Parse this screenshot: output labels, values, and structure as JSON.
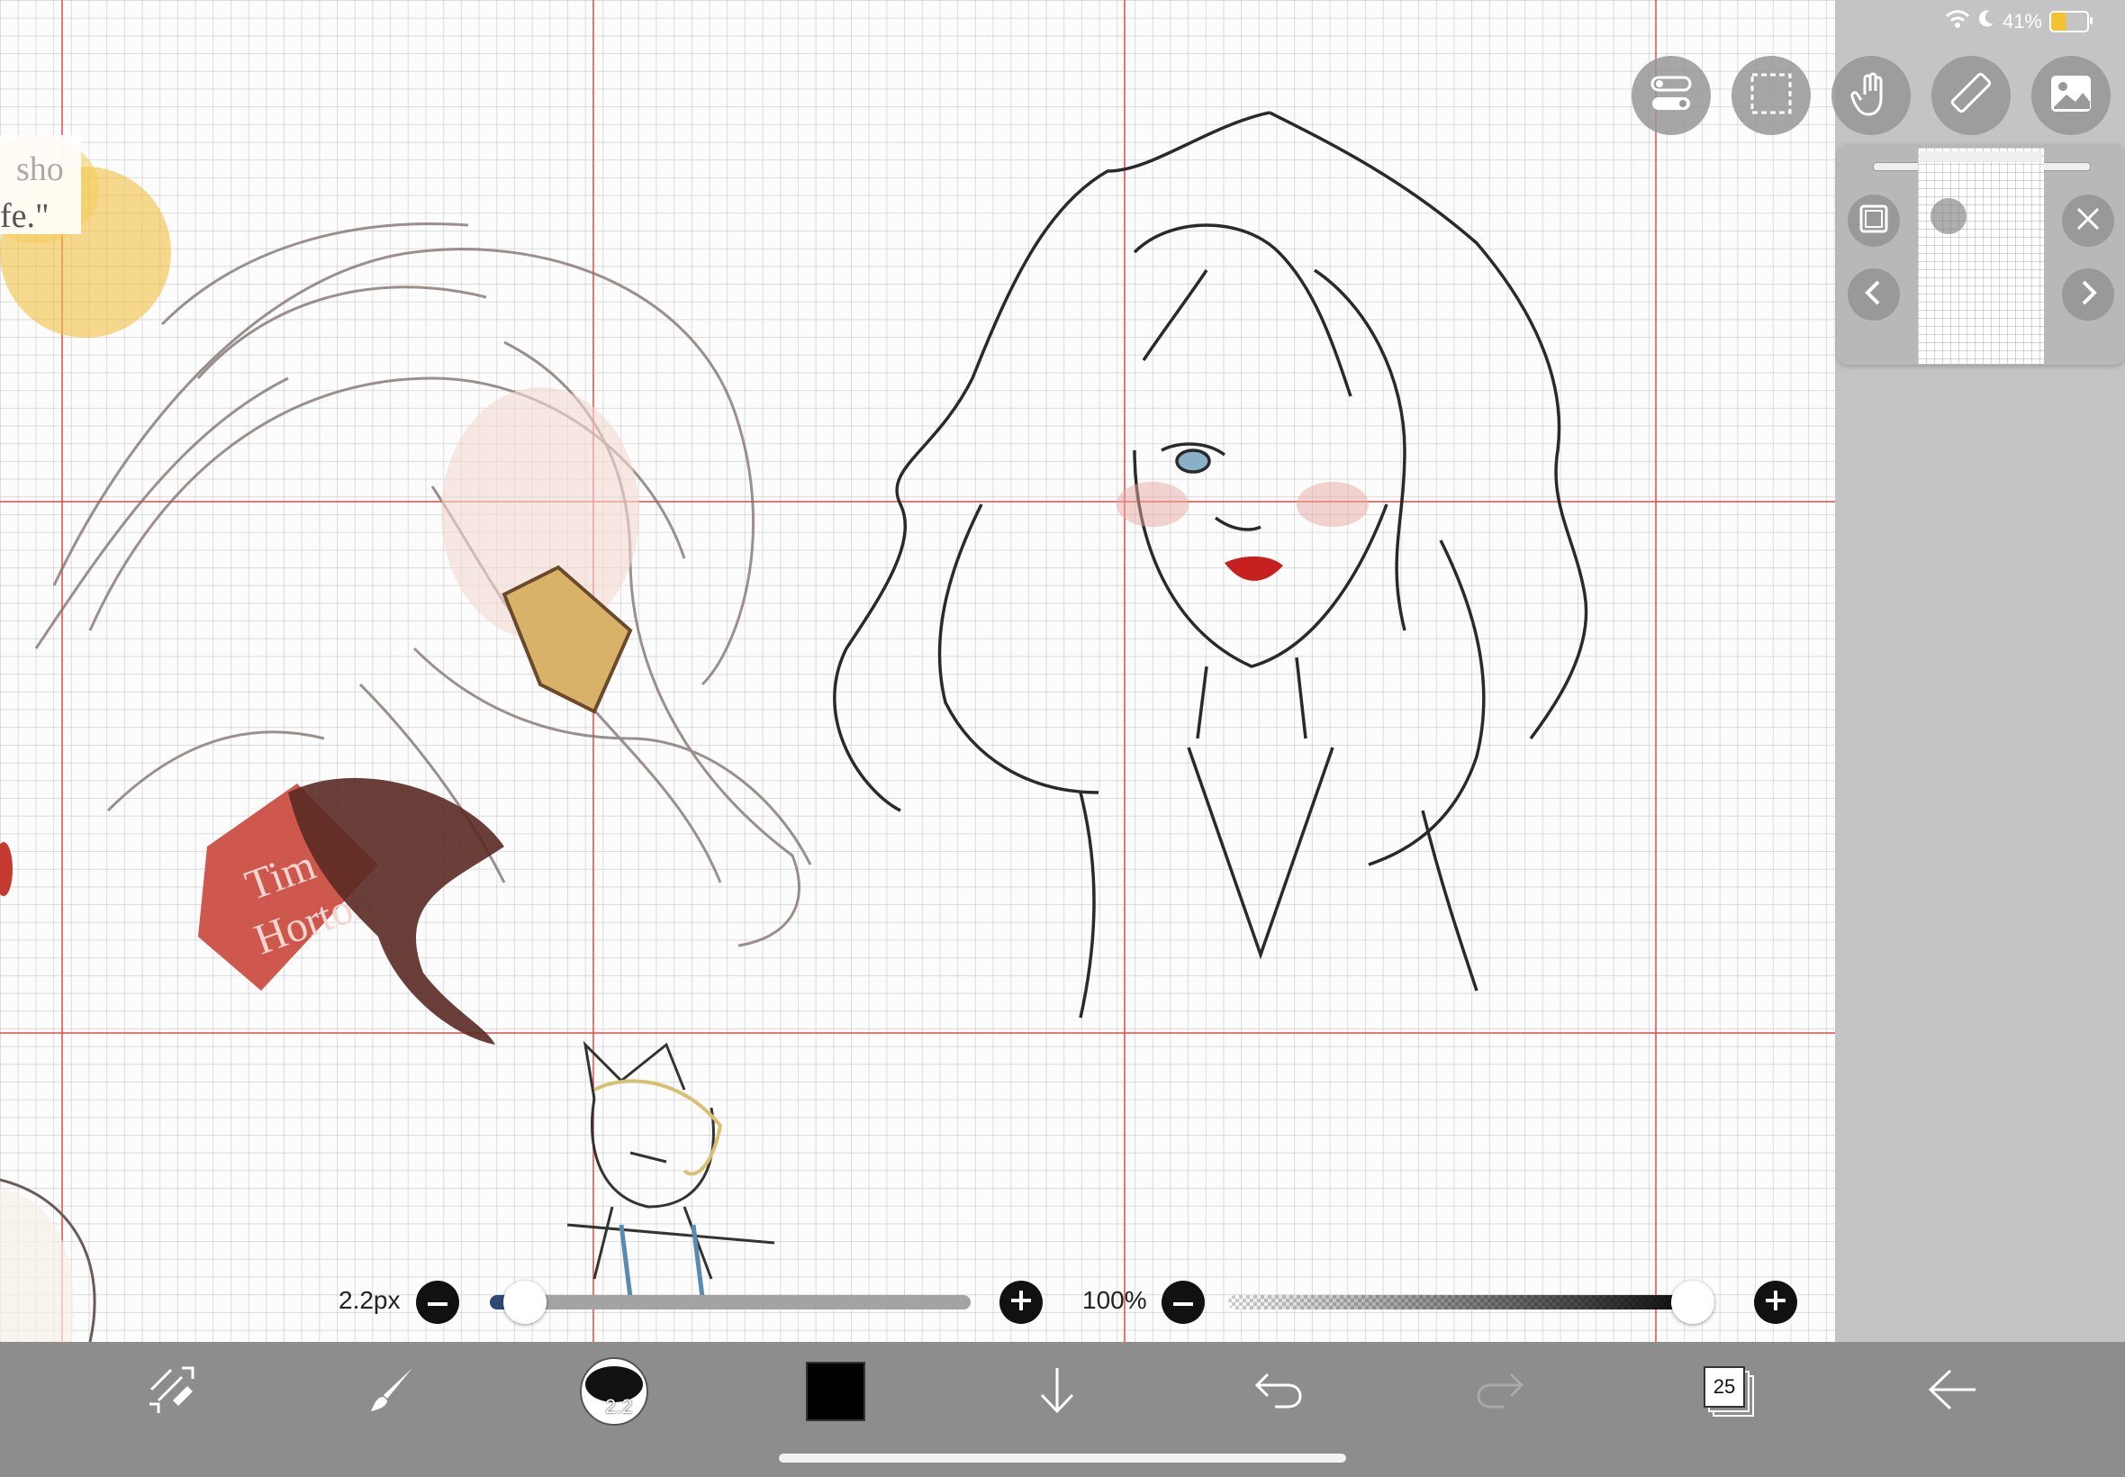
{
  "status_bar": {
    "battery_percent": "41%",
    "battery_level": 0.41,
    "icons": [
      "wifi-icon",
      "moon-icon",
      "battery-charging-icon"
    ]
  },
  "canvas": {
    "quote_fragment_1": "sho",
    "quote_fragment_2": "fe.\""
  },
  "top_tools": [
    {
      "name": "layer-toggle-icon"
    },
    {
      "name": "selection-icon"
    },
    {
      "name": "hand-tool-icon"
    },
    {
      "name": "ruler-icon"
    },
    {
      "name": "image-icon"
    }
  ],
  "navigator": {
    "icons": [
      "frame-icon",
      "close-icon",
      "previous-icon",
      "next-icon"
    ]
  },
  "brush_size": {
    "label": "2.2px",
    "level": 0.03
  },
  "opacity": {
    "label": "100%",
    "level": 1.0
  },
  "toolbar": {
    "brush_preview_label": "2.2",
    "current_color": "#000000",
    "layers_count": "25",
    "icons": [
      "transform-icon",
      "brush-icon",
      "brush-size-icon",
      "color-swatch",
      "download-icon",
      "undo-icon",
      "redo-icon",
      "layers-icon",
      "back-arrow-icon"
    ]
  },
  "colors": {
    "toolbar_bg": "#8d8d8d",
    "panel_bg": "#c4c4c4",
    "guide": "#e04a4a"
  }
}
